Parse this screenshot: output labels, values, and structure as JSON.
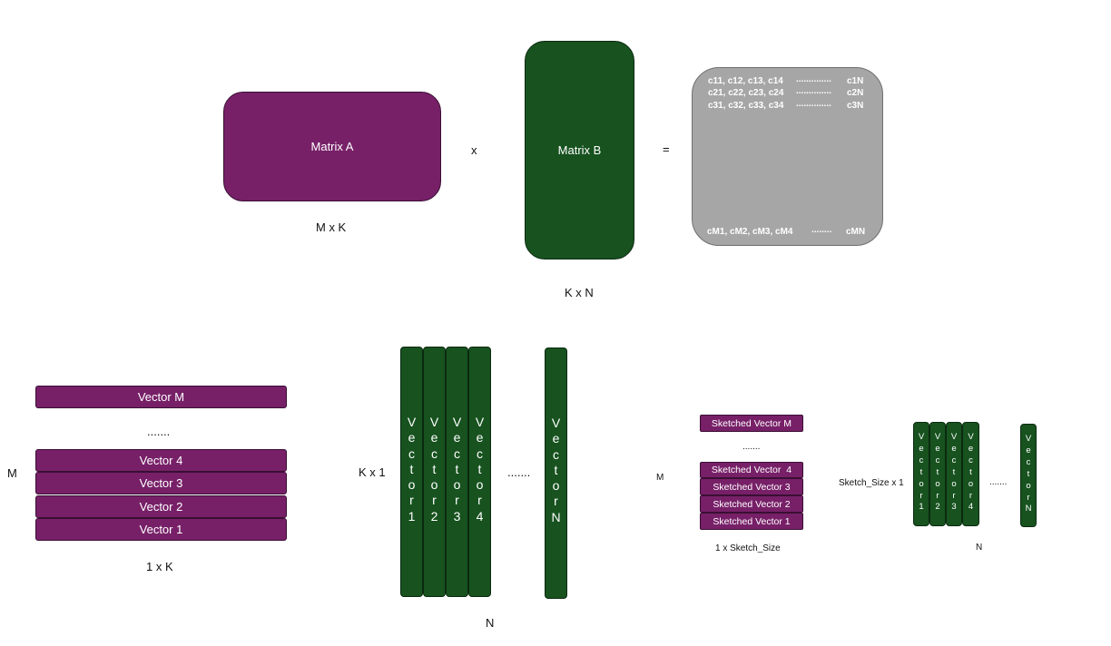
{
  "top": {
    "matrix_a": {
      "title": "Matrix A",
      "dims": "M x K"
    },
    "times_symbol": "x",
    "matrix_b": {
      "title": "Matrix B",
      "dims": "K x N"
    },
    "equals_symbol": "=",
    "result": {
      "rows": [
        {
          "cells": "c11, c12, c13, c14",
          "dots": "..............",
          "end": "c1N"
        },
        {
          "cells": "c21, c22, c23, c24",
          "dots": "..............",
          "end": "c2N"
        },
        {
          "cells": "c31, c32, c33, c34",
          "dots": "..............",
          "end": "c3N"
        }
      ],
      "last_row": {
        "cells": "cM1, cM2, cM3, cM4",
        "dots": "........",
        "end": "cMN"
      }
    }
  },
  "bottom_left": {
    "side_label": "M",
    "vectors": [
      "Vector M",
      "Vector 4",
      "Vector 3",
      "Vector 2",
      "Vector 1"
    ],
    "ellipsis": ".......",
    "dims": "1 x K"
  },
  "bottom_middle": {
    "side_label": "K x 1",
    "columns": [
      "V\ne\nc\nt\no\nr\n1",
      "V\ne\nc\nt\no\nr\n2",
      "V\ne\nc\nt\no\nr\n3",
      "V\ne\nc\nt\no\nr\n4"
    ],
    "ellipsis": ".......",
    "last_column": "V\ne\nc\nt\no\nr\nN",
    "dims": "N"
  },
  "sketched_left": {
    "side_label": "M",
    "vectors": [
      "Sketched Vector M",
      "Sketched Vector  4",
      "Sketched Vector 3",
      "Sketched Vector 2",
      "Sketched Vector 1"
    ],
    "ellipsis": ".......",
    "dims": "1 x Sketch_Size"
  },
  "sketched_right": {
    "side_label": "Sketch_Size x 1",
    "columns": [
      "V\ne\nc\nt\no\nr\n1",
      "V\ne\nc\nt\no\nr\n2",
      "V\ne\nc\nt\no\nr\n3",
      "V\ne\nc\nt\no\nr\n4"
    ],
    "ellipsis": ".......",
    "last_column": "V\ne\nc\nt\no\nr\nN",
    "dims": "N"
  },
  "colors": {
    "purple": "#772068",
    "green": "#17521f",
    "gray": "#a6a6a6"
  }
}
